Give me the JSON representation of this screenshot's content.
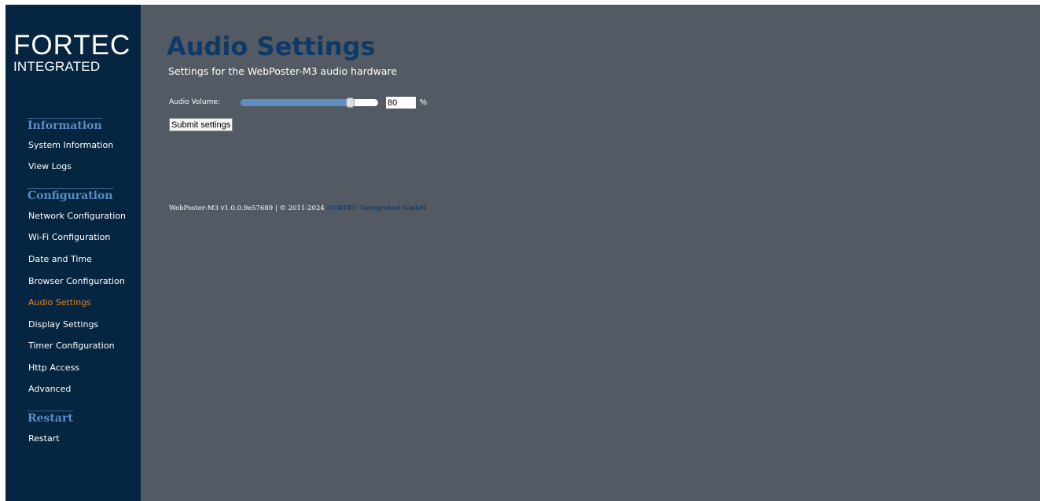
{
  "logo": {
    "main": "FORTEC",
    "sub": "INTEGRATED"
  },
  "sidebar": {
    "sections": [
      {
        "header": "Information",
        "items": [
          "System Information",
          "View Logs"
        ]
      },
      {
        "header": "Configuration",
        "items": [
          "Network Configuration",
          "Wi-Fi Configuration",
          "Date and Time",
          "Browser Configuration",
          "Audio Settings",
          "Display Settings",
          "Timer Configuration",
          "Http Access",
          "Advanced"
        ]
      },
      {
        "header": "Restart",
        "items": [
          "Restart"
        ]
      }
    ],
    "active_item": "Audio Settings"
  },
  "main": {
    "title": "Audio Settings",
    "subtitle": "Settings for the WebPoster-M3 audio hardware",
    "volume": {
      "label": "Audio Volume:",
      "value": "80",
      "level_percent": 80,
      "unit": "%"
    },
    "submit_label": "Submit settings",
    "footer": {
      "text": "WebPoster-M3 v1.0.0.9e57689 | © 2011-2024 ",
      "link": "FORTEC Integrated GmbH"
    }
  },
  "colors": {
    "sidebar_bg": "#062540",
    "main_bg": "#545a63",
    "title": "#0e3a68",
    "section_header": "#5b8cc4",
    "active_nav": "#e8861c",
    "slider_fill": "#5f8dc0"
  }
}
